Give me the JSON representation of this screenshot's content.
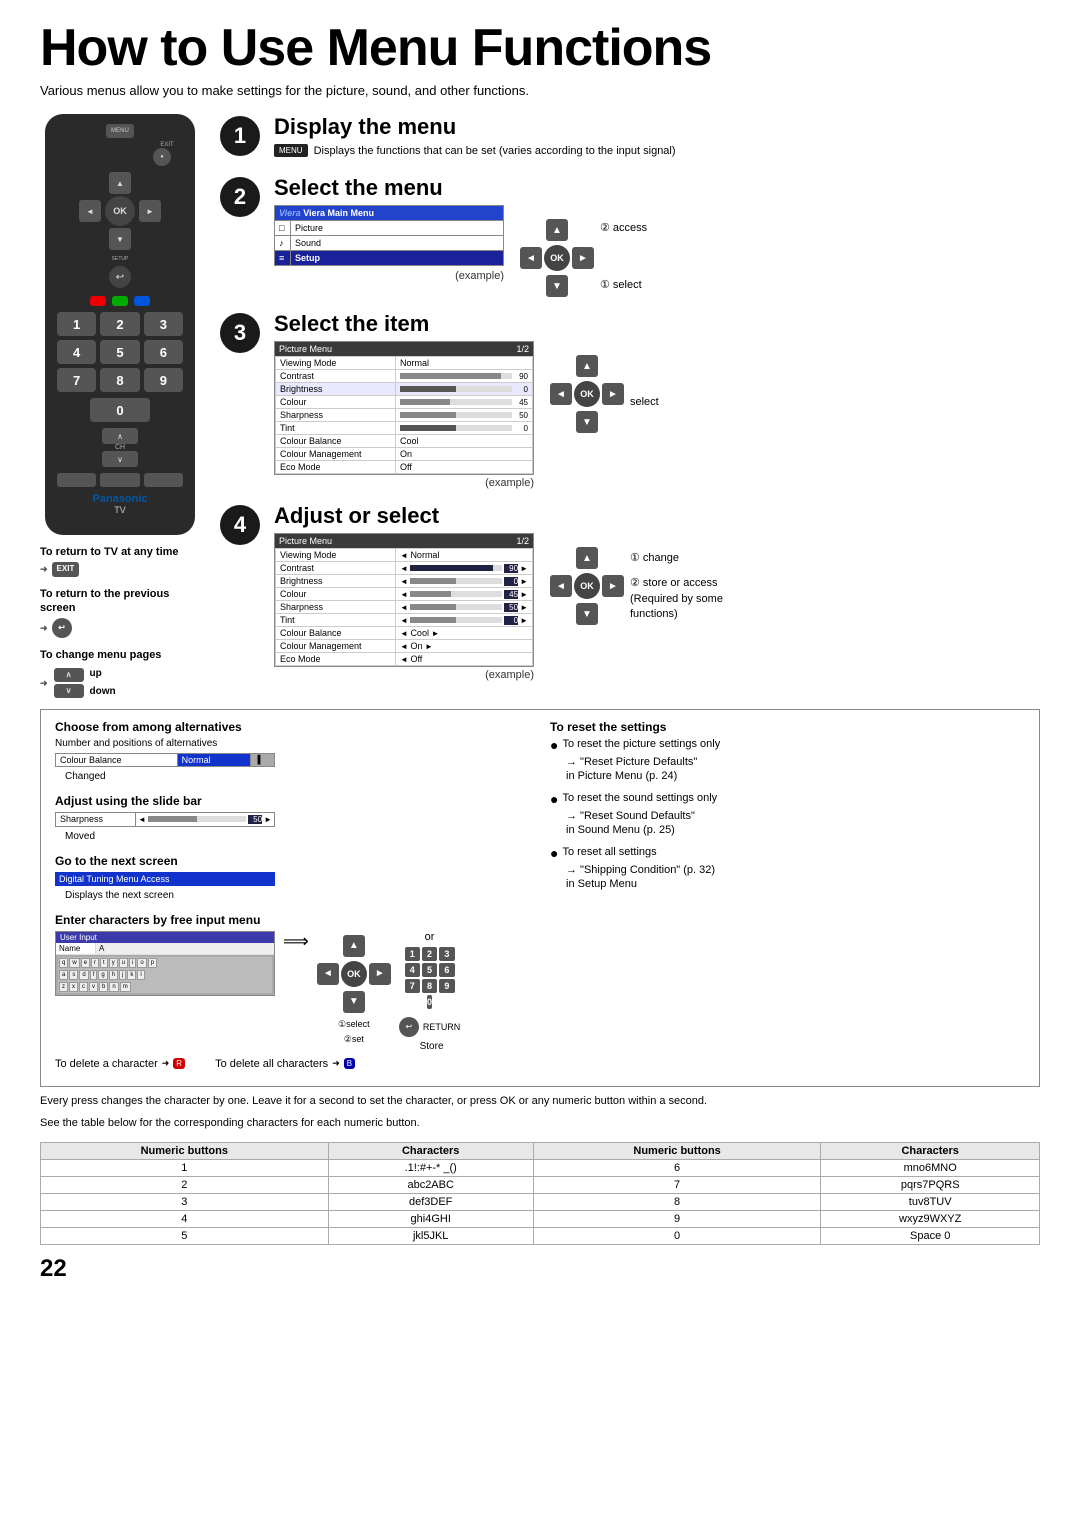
{
  "page": {
    "title": "How to Use Menu Functions",
    "subtitle": "Various menus allow you to make settings for the picture, sound, and other functions.",
    "page_number": "22"
  },
  "steps": [
    {
      "number": "1",
      "title": "Display the menu",
      "button_label": "MENU",
      "description": "Displays the functions that can be set (varies according to the input signal)"
    },
    {
      "number": "2",
      "title": "Select the menu",
      "example_label": "(example)",
      "menu_items": [
        {
          "icon": "□",
          "label": "Picture",
          "highlight": false
        },
        {
          "icon": "♪",
          "label": "Sound",
          "highlight": false
        },
        {
          "icon": "≡",
          "label": "Setup",
          "highlight": true
        }
      ],
      "menu_header": "Viera Main Menu",
      "nav_labels": [
        "② access",
        "① select"
      ]
    },
    {
      "number": "3",
      "title": "Select the item",
      "example_label": "(example)",
      "picture_menu": {
        "header": "Picture Menu",
        "page": "1/2",
        "rows": [
          {
            "label": "Viewing Mode",
            "value": "Normal",
            "bar": false
          },
          {
            "label": "Contrast",
            "value": "90",
            "bar": true,
            "pct": 90
          },
          {
            "label": "Brightness",
            "value": "0",
            "bar": true,
            "pct": 0,
            "highlight": true
          },
          {
            "label": "Colour",
            "value": "45",
            "bar": true,
            "pct": 45
          },
          {
            "label": "Sharpness",
            "value": "50",
            "bar": true,
            "pct": 50
          },
          {
            "label": "Tint",
            "value": "0",
            "bar": true,
            "pct": 0
          },
          {
            "label": "Colour Balance",
            "value": "Cool",
            "bar": false
          },
          {
            "label": "Colour Management",
            "value": "On",
            "bar": false
          },
          {
            "label": "Eco Mode",
            "value": "Off",
            "bar": false
          }
        ]
      },
      "nav_label": "select"
    },
    {
      "number": "4",
      "title": "Adjust or select",
      "example_label": "(example)",
      "picture_menu": {
        "header": "Picture Menu",
        "page": "1/2",
        "rows": [
          {
            "label": "Viewing Mode",
            "value": "Normal",
            "bar": false
          },
          {
            "label": "Contrast",
            "value": "90",
            "bar": true,
            "pct": 90
          },
          {
            "label": "Brightness",
            "value": "0",
            "bar": true,
            "pct": 0
          },
          {
            "label": "Colour",
            "value": "45",
            "bar": true,
            "pct": 45
          },
          {
            "label": "Sharpness",
            "value": "50",
            "bar": true,
            "pct": 50
          },
          {
            "label": "Tint",
            "value": "0",
            "bar": true,
            "pct": 0
          },
          {
            "label": "Colour Balance",
            "value": "Cool",
            "bar": false
          },
          {
            "label": "Colour Management",
            "value": "On",
            "bar": false
          },
          {
            "label": "Eco Mode",
            "value": "Off",
            "bar": false
          }
        ]
      },
      "nav_labels": [
        "① change",
        "② store or access\n(Required by some\nfunctions)"
      ]
    }
  ],
  "remote_labels": {
    "menu": "MENU",
    "exit": "EXIT",
    "return": "RETURN",
    "setup": "SETUP",
    "ok": "OK",
    "ch": "CH",
    "panasonic": "Panasonic",
    "tv": "TV"
  },
  "info_sections": {
    "choose_alternatives": {
      "title": "Choose from among alternatives",
      "subtitle": "Number and positions of alternatives",
      "changed_label": "Changed",
      "row": {
        "label": "Colour Balance",
        "value": "Normal"
      }
    },
    "adjust_slide": {
      "title": "Adjust using the slide bar",
      "moved_label": "Moved",
      "row": {
        "label": "Sharpness",
        "value": "50"
      }
    },
    "next_screen": {
      "title": "Go to the next screen",
      "label": "Digital Tuning Menu Access",
      "sub": "Displays the next screen"
    },
    "free_input": {
      "title": "Enter characters by free input menu",
      "user_input_label": "User Input",
      "name_label": "Name",
      "name_value": "A",
      "select_label": "①select",
      "set_label": "②set",
      "or_label": "or",
      "return_label": "RETURN",
      "store_label": "Store",
      "delete_char_label": "To delete a character",
      "delete_all_label": "To delete all characters"
    },
    "reset": {
      "title": "To reset the settings",
      "items": [
        {
          "text": "To reset the picture settings only",
          "arrow": "→ \"Reset Picture Defaults\"",
          "sub": "in Picture Menu (p. 24)"
        },
        {
          "text": "To reset the sound settings only",
          "arrow": "→ \"Reset Sound Defaults\"",
          "sub": "in Sound Menu (p. 25)"
        },
        {
          "text": "To reset all settings",
          "arrow": "→ \"Shipping Condition\" (p. 32)",
          "sub": "in Setup Menu"
        }
      ]
    }
  },
  "return_sections": [
    {
      "title": "To return to TV at any time",
      "button": "EXIT"
    },
    {
      "title": "To return to the previous screen",
      "button": "RETURN"
    },
    {
      "title": "To change menu pages",
      "up_label": "up",
      "down_label": "down"
    }
  ],
  "para_text": "Every press changes the character by one. Leave it for a second to set the character, or press OK or any numeric button within a second.",
  "see_text": "See the table below for the corresponding characters for each numeric button.",
  "char_table": {
    "headers": [
      "Numeric buttons",
      "Characters",
      "Numeric buttons",
      "Characters"
    ],
    "rows": [
      [
        "1",
        ".1!:#+-* _()",
        "6",
        "mno6MNO"
      ],
      [
        "2",
        "abc2ABC",
        "7",
        "pqrs7PQRS"
      ],
      [
        "3",
        "def3DEF",
        "8",
        "tuv8TUV"
      ],
      [
        "4",
        "ghi4GHI",
        "9",
        "wxyz9WXYZ"
      ],
      [
        "5",
        "jkl5JKL",
        "0",
        "Space 0"
      ]
    ]
  }
}
